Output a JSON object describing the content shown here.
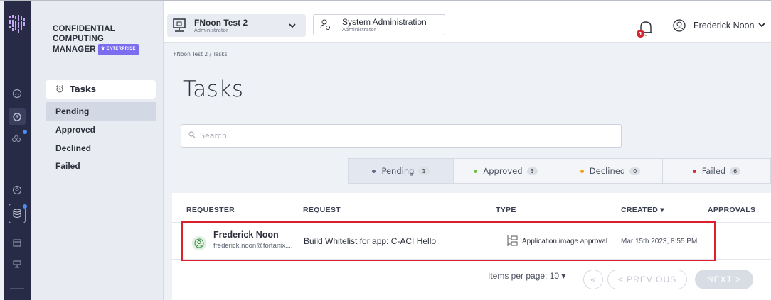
{
  "brand": {
    "line1": "CONFIDENTIAL",
    "line2": "COMPUTING",
    "line3": "MANAGER",
    "edition": "ENTERPRISE"
  },
  "header": {
    "account_name": "FNoon Test 2",
    "account_role": "Administrator",
    "system_name": "System Administration",
    "system_role": "Administrator",
    "notification_count": "1",
    "user_name": "Frederick Noon"
  },
  "sidenav": {
    "section_label": "Tasks",
    "items": [
      {
        "label": "Pending"
      },
      {
        "label": "Approved"
      },
      {
        "label": "Declined"
      },
      {
        "label": "Failed"
      }
    ]
  },
  "breadcrumb": "FNoon Test 2 / Tasks",
  "page_title": "Tasks",
  "search": {
    "placeholder": "Search"
  },
  "tabs": [
    {
      "label": "Pending",
      "count": "1",
      "color": "#5a6b8c"
    },
    {
      "label": "Approved",
      "count": "3",
      "color": "#6ec04b"
    },
    {
      "label": "Declined",
      "count": "0",
      "color": "#f0a020"
    },
    {
      "label": "Failed",
      "count": "6",
      "color": "#d9262f"
    }
  ],
  "table": {
    "columns": [
      "REQUESTER",
      "REQUEST",
      "TYPE",
      "CREATED",
      "APPROVALS"
    ],
    "rows": [
      {
        "requester_name": "Frederick Noon",
        "requester_email": "frederick.noon@fortanix....",
        "request": "Build Whitelist for app: C-ACI Hello",
        "type": "Application image approval",
        "created": "Mar 15th 2023, 8:55 PM"
      }
    ]
  },
  "pagination": {
    "items_per_page_label": "Items per page: 10",
    "first": "«",
    "previous": "< PREVIOUS",
    "next": "NEXT >"
  },
  "colors": {
    "rail": "#272b45",
    "highlight": "#dd1f2d",
    "enterprise_badge": "#7c6cf0"
  }
}
